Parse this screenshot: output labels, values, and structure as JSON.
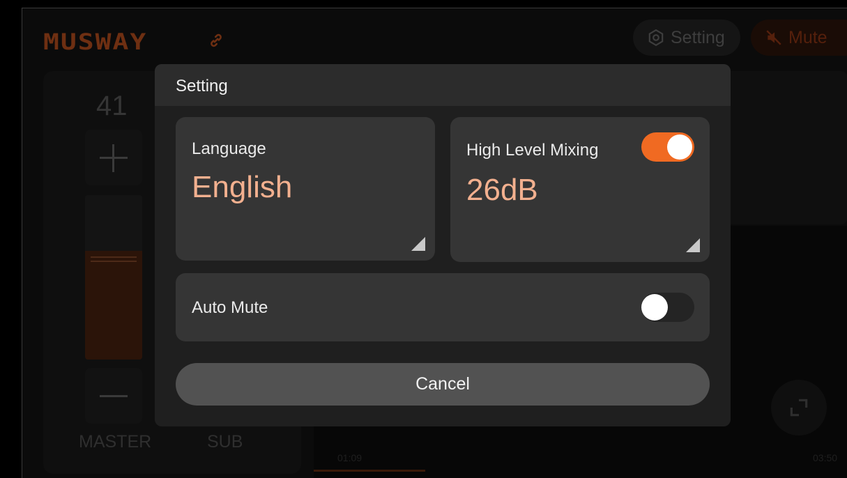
{
  "background": {
    "logo_text": "MUSWAY",
    "header": {
      "setting_label": "Setting",
      "mute_label": "Mute"
    },
    "fader": {
      "value": "41",
      "level": 0.66,
      "channels": [
        "MASTER",
        "SUB"
      ]
    },
    "player": {
      "time_current": "01:09",
      "time_total": "03:50"
    }
  },
  "dialog": {
    "title": "Setting",
    "language": {
      "label": "Language",
      "value": "English"
    },
    "high_level_mixing": {
      "label": "High Level Mixing",
      "value": "26dB",
      "enabled": true
    },
    "auto_mute": {
      "label": "Auto Mute",
      "enabled": false
    },
    "cancel_label": "Cancel"
  },
  "colors": {
    "accent": "#f06a22",
    "value_text": "#f2b08f",
    "dialog_bg": "#1f1f1f",
    "card_bg": "#353535"
  }
}
